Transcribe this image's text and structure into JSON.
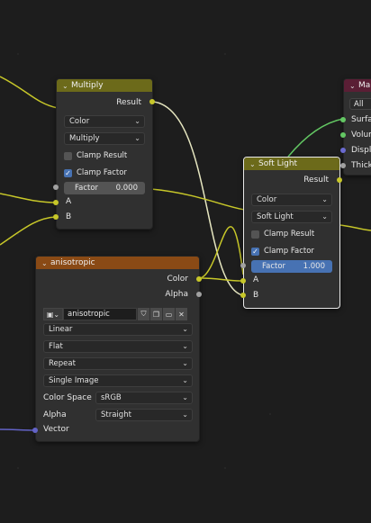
{
  "multiply_node": {
    "title": "Multiply",
    "output_result": "Result",
    "type_select": "Color",
    "operation_select": "Multiply",
    "clamp_result": {
      "label": "Clamp Result",
      "checked": false
    },
    "clamp_factor": {
      "label": "Clamp Factor",
      "checked": true
    },
    "factor": {
      "label": "Factor",
      "value": "0.000"
    },
    "input_a": "A",
    "input_b": "B"
  },
  "soft_light_node": {
    "title": "Soft Light",
    "output_result": "Result",
    "type_select": "Color",
    "operation_select": "Soft Light",
    "clamp_result": {
      "label": "Clamp Result",
      "checked": false
    },
    "clamp_factor": {
      "label": "Clamp Factor",
      "checked": true
    },
    "factor": {
      "label": "Factor",
      "value": "1.000"
    },
    "input_a": "A",
    "input_b": "B"
  },
  "texture_node": {
    "title": "anisotropic",
    "output_color": "Color",
    "output_alpha": "Alpha",
    "image_name": "anisotropic",
    "interpolation": "Linear",
    "projection": "Flat",
    "extension": "Repeat",
    "source": "Single Image",
    "color_space_label": "Color Space",
    "color_space": "sRGB",
    "alpha_label": "Alpha",
    "alpha_mode": "Straight",
    "input_vector": "Vector"
  },
  "material_output_node": {
    "title": "Ma",
    "target": "All",
    "inputs": [
      "Surfac",
      "Volum",
      "Displa",
      "Thickn"
    ]
  },
  "colors": {
    "converter_header": "#6c6a1a",
    "texture_header": "#8a4a15",
    "output_header": "#5a1e35",
    "socket_color": "#c7c729",
    "socket_float": "#a1a1a1",
    "socket_shader": "#63c763",
    "socket_vector": "#6363c7",
    "accent_blue": "#4772b3"
  }
}
